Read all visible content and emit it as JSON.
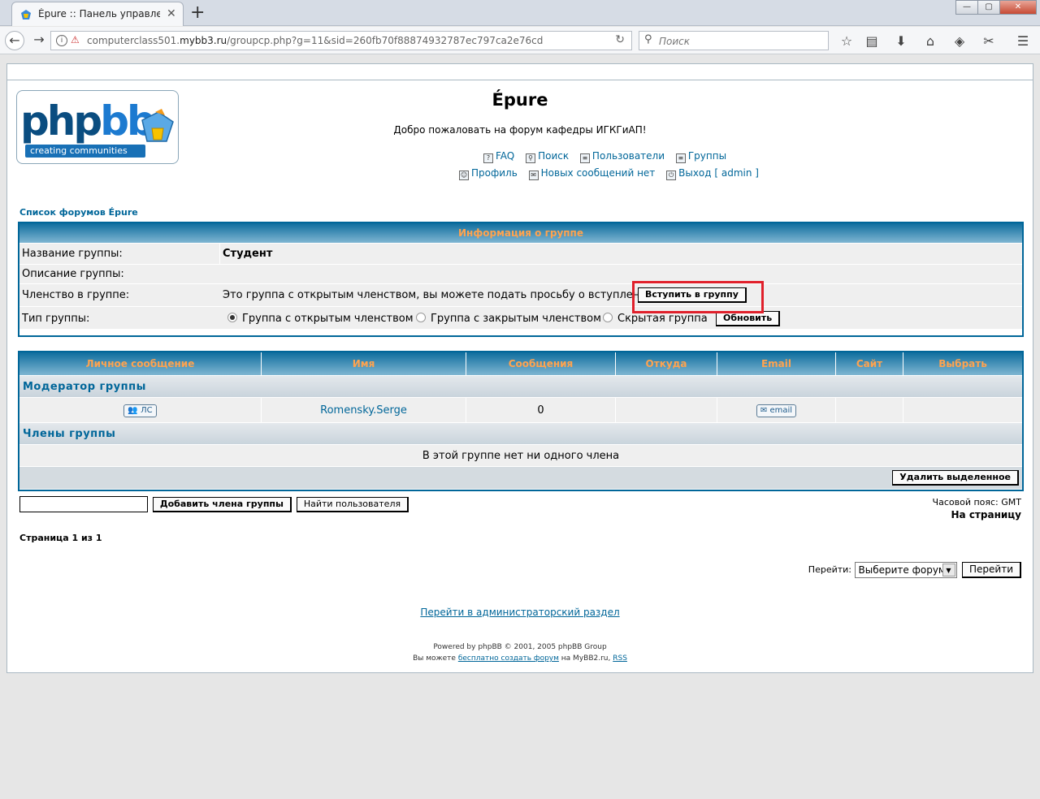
{
  "browser": {
    "tab_title": "Épure :: Панель управления",
    "tab_close": "✕",
    "new_tab": "+",
    "win_min": "—",
    "win_max": "▢",
    "win_close": "✕",
    "url_prefix": "computerclass501.",
    "url_domain": "mybb3.ru",
    "url_path": "/groupcp.php?g=11&sid=260fb70f88874932787ec797ca2e76cd",
    "search_placeholder": "Поиск",
    "icons": [
      "star-icon",
      "reader-icon",
      "download-icon",
      "home-icon",
      "pocket-icon",
      "tools-icon",
      "menu-icon"
    ]
  },
  "site": {
    "logo_text_a": "php",
    "logo_text_b": "bb",
    "logo_tag": "creating  communities",
    "title": "Épure",
    "description": "Добро пожаловать на форум кафедры ИГКГиАП!"
  },
  "nav": {
    "faq": "FAQ",
    "search": "Поиск",
    "users": "Пользователи",
    "groups": "Группы",
    "profile": "Профиль",
    "new_posts": "Новых сообщений нет",
    "logout": "Выход [ admin ]"
  },
  "breadcrumb": "Список форумов Épure",
  "group_info": {
    "header": "Информация о группе",
    "name_label": "Название группы:",
    "name_value": "Студент",
    "desc_label": "Описание группы:",
    "desc_value": "",
    "membership_label": "Членство в группе:",
    "membership_text": "Это группа с открытым членством, вы можете подать просьбу о вступлении",
    "join_button": "Вступить в группу",
    "type_label": "Тип группы:",
    "type_open": "Группа с открытым членством",
    "type_closed": "Группа с закрытым членством",
    "type_hidden": "Скрытая группа",
    "update_button": "Обновить"
  },
  "members": {
    "columns": [
      "Личное сообщение",
      "Имя",
      "Сообщения",
      "Откуда",
      "Email",
      "Сайт",
      "Выбрать"
    ],
    "moderator_header": "Модератор группы",
    "moderator": {
      "pm_label": "ЛС",
      "name": "Romensky.Serge",
      "posts": "0",
      "from": "",
      "email_label": "email",
      "site": "",
      "select": ""
    },
    "members_header": "Члены группы",
    "empty_text": "В этой группе нет ни одного члена",
    "delete_button": "Удалить выделенное"
  },
  "bottom": {
    "add_member_button": "Добавить члена группы",
    "find_user_button": "Найти пользователя",
    "timezone": "Часовой пояс: GMT",
    "to_page": "На страницу",
    "page_of": "Страница 1 из 1",
    "jump_label": "Перейти:",
    "jump_select": "Выберите форум",
    "jump_button": "Перейти",
    "admin_link": "Перейти в администраторский раздел",
    "footer_powered": "Powered by phpBB © 2001, 2005 phpBB Group",
    "footer_prefix": "Вы можете",
    "footer_link": "бесплатно создать форум",
    "footer_mid": "на MyBB2.ru,",
    "footer_rss": "RSS"
  }
}
